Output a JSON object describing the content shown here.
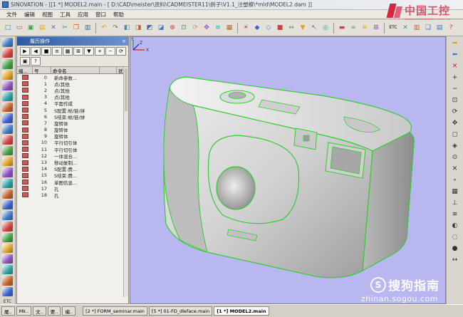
{
  "window": {
    "title": "SINOVATION - [[1 *] MODEL2.main - [ D:\\CAD\\meister\\资料\\CADMEISTER11\\例子\\V1.1_注塑模\\*mld\\MODEL2.dam ]]"
  },
  "menu": [
    "文件",
    "编辑",
    "视图",
    "工具",
    "应用",
    "窗口",
    "帮助"
  ],
  "watermark_logo": {
    "text": "中国工控",
    "subtext": "www.gongkong.com.cn"
  },
  "toolbar": {
    "groups": [
      [
        "new-icon",
        "open-icon",
        "save-icon",
        "print-icon",
        "delete-icon",
        "cut-icon",
        "copy-icon",
        "paste-icon"
      ],
      [
        "undo-icon",
        "redo-icon",
        "view-front-icon",
        "view-top-icon",
        "view-right-icon",
        "view-iso-icon",
        "zoom-icon",
        "fit-icon",
        "rotate-icon",
        "pan-icon",
        "layer-icon",
        "grid-icon"
      ],
      [
        "light-icon",
        "render-icon",
        "wireframe-icon",
        "shade-icon",
        "measure-icon",
        "filter-icon",
        "select-icon",
        "snap-icon"
      ],
      [
        "section-icon",
        "binocular-icon",
        "analysis-icon",
        "tree-icon"
      ],
      [
        "etc-icon",
        "close-x-icon",
        "tile-icon",
        "cascade-icon",
        "arrange-icon",
        "help-icon"
      ]
    ],
    "etc_label": "ETC"
  },
  "left_strip": {
    "icons": [
      "solid-box-icon",
      "extrude-icon",
      "revolve-icon",
      "sweep-icon",
      "loft-icon",
      "fillet-icon",
      "chamfer-icon",
      "shell-icon",
      "draft-icon",
      "boolean-icon",
      "split-icon",
      "offset-icon",
      "surface-icon",
      "blend-icon",
      "trim-icon",
      "extend-icon",
      "sew-icon",
      "mirror-icon",
      "pattern-icon",
      "transform-icon",
      "sketch-icon",
      "curve-icon",
      "point-icon",
      "plane-icon"
    ],
    "etc_label": "ETC"
  },
  "right_strip": {
    "icons": [
      "arrow-right-icon",
      "arrow-left-icon",
      "close-x-icon",
      "zoom-in-icon",
      "zoom-out-icon",
      "fit-window-icon",
      "rotate-icon",
      "pan-icon",
      "snap-end-icon",
      "snap-mid-icon",
      "snap-center-icon",
      "snap-intersect-icon",
      "snap-near-icon",
      "grid-snap-icon",
      "ortho-icon",
      "layer-icon",
      "color-icon",
      "hide-icon",
      "show-icon",
      "measure-icon"
    ]
  },
  "history_panel": {
    "title": "履历操作",
    "close_label": "×",
    "tools": [
      "play-icon",
      "step-back-icon",
      "stop-icon",
      "list-icon",
      "grid-icon",
      "tree-icon",
      "filter-icon",
      "expand-icon",
      "collapse-icon",
      "refresh-icon",
      "lock-icon",
      "help-icon"
    ],
    "columns": [
      "编...",
      "号",
      "命令名",
      "",
      "状"
    ],
    "rows": [
      {
        "no": "0",
        "name": "新命参数..."
      },
      {
        "no": "1",
        "name": "点/其他"
      },
      {
        "no": "2",
        "name": "点/其他"
      },
      {
        "no": "3",
        "name": "点/其他"
      },
      {
        "no": "4",
        "name": "平面作成"
      },
      {
        "no": "5",
        "name": "S配置:帧/链/拼"
      },
      {
        "no": "6",
        "name": "S结束:帧/链/拼"
      },
      {
        "no": "7",
        "name": "旋转体"
      },
      {
        "no": "8",
        "name": "旋转体"
      },
      {
        "no": "9",
        "name": "旋转体"
      },
      {
        "no": "10",
        "name": "平行切引体"
      },
      {
        "no": "11",
        "name": "平行切引体"
      },
      {
        "no": "12",
        "name": "一体混合..."
      },
      {
        "no": "13",
        "name": "移动复制..."
      },
      {
        "no": "14",
        "name": "S配置:费..."
      },
      {
        "no": "15",
        "name": "S结束:费..."
      },
      {
        "no": "16",
        "name": "单图信息..."
      },
      {
        "no": "17",
        "name": "孔"
      },
      {
        "no": "18",
        "name": "孔"
      }
    ]
  },
  "viewport": {
    "model": "camera-body-model",
    "background": "#b9b7f0",
    "edge_color": "#33cc33",
    "axis_labels": {
      "x": "X",
      "y": "Y",
      "z": "Z"
    }
  },
  "watermark": {
    "badge_letter": "S",
    "text": "搜狗指南",
    "url": "zhinan.sogou.com"
  },
  "bottom_tabs": [
    {
      "label": "履..",
      "active": false
    },
    {
      "label": "Mk..",
      "active": false
    },
    {
      "label": "文..",
      "active": false
    },
    {
      "label": "要..",
      "active": false
    },
    {
      "label": "编..",
      "active": false
    },
    {
      "label": "[2 *] FORM_seminar.main",
      "active": false
    },
    {
      "label": "[5 *] 01-FD_dleface.main",
      "active": false
    },
    {
      "label": "[1 *] MODEL2.main",
      "active": true
    }
  ]
}
